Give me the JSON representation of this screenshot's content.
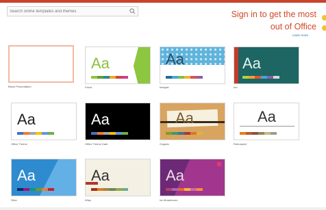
{
  "search": {
    "placeholder": "Search online templates and themes"
  },
  "signin": {
    "line1": "Sign in to get the most",
    "line2": "out of Office",
    "learn_more": "Learn more"
  },
  "templates": [
    {
      "id": "blank",
      "caption": "Blank Presentation"
    },
    {
      "id": "facet",
      "caption": "Facet",
      "thumb_text": "Aa"
    },
    {
      "id": "integral",
      "caption": "Integral",
      "thumb_text": "Aa"
    },
    {
      "id": "ion",
      "caption": "Ion",
      "thumb_text": "Aa"
    },
    {
      "id": "office-theme",
      "caption": "Office Theme",
      "thumb_text": "Aa"
    },
    {
      "id": "office-theme-dark",
      "caption": "Office Theme Dark",
      "thumb_text": "Aa"
    },
    {
      "id": "organic",
      "caption": "Organic",
      "thumb_text": "Aa"
    },
    {
      "id": "retrospect",
      "caption": "Retrospect",
      "thumb_text": "Aa"
    },
    {
      "id": "slice",
      "caption": "Slice",
      "thumb_text": "Aa"
    },
    {
      "id": "wisp",
      "caption": "Wisp",
      "thumb_text": "Aa"
    },
    {
      "id": "parcel",
      "caption": "Ion Boardroom",
      "thumb_text": "Aa"
    }
  ],
  "colors": {
    "accent": "#d24726",
    "top_bar": "#c9432b",
    "selected_border": "#f2b8a3"
  }
}
